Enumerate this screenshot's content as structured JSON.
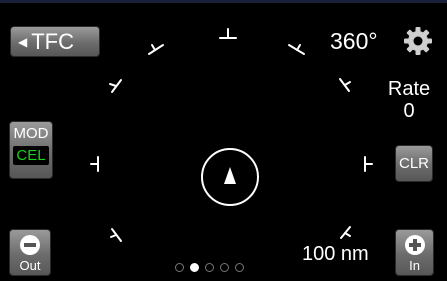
{
  "header": {
    "traffic_button_label": "TFC",
    "traffic_button_icon": "left-triangle-arrow",
    "heading": "360°",
    "settings_icon": "gear"
  },
  "rate": {
    "label": "Rate",
    "value": "0"
  },
  "mode": {
    "label": "MOD",
    "value": "CEL",
    "value_color": "#1ad21a"
  },
  "clear_button_label": "CLR",
  "zoom": {
    "out_label": "Out",
    "out_icon": "minus-circle",
    "in_label": "In",
    "in_icon": "plus-circle",
    "range": "100 nm"
  },
  "ownship_icon": "triangle-up",
  "pager": {
    "count": 5,
    "active_index": 1
  }
}
